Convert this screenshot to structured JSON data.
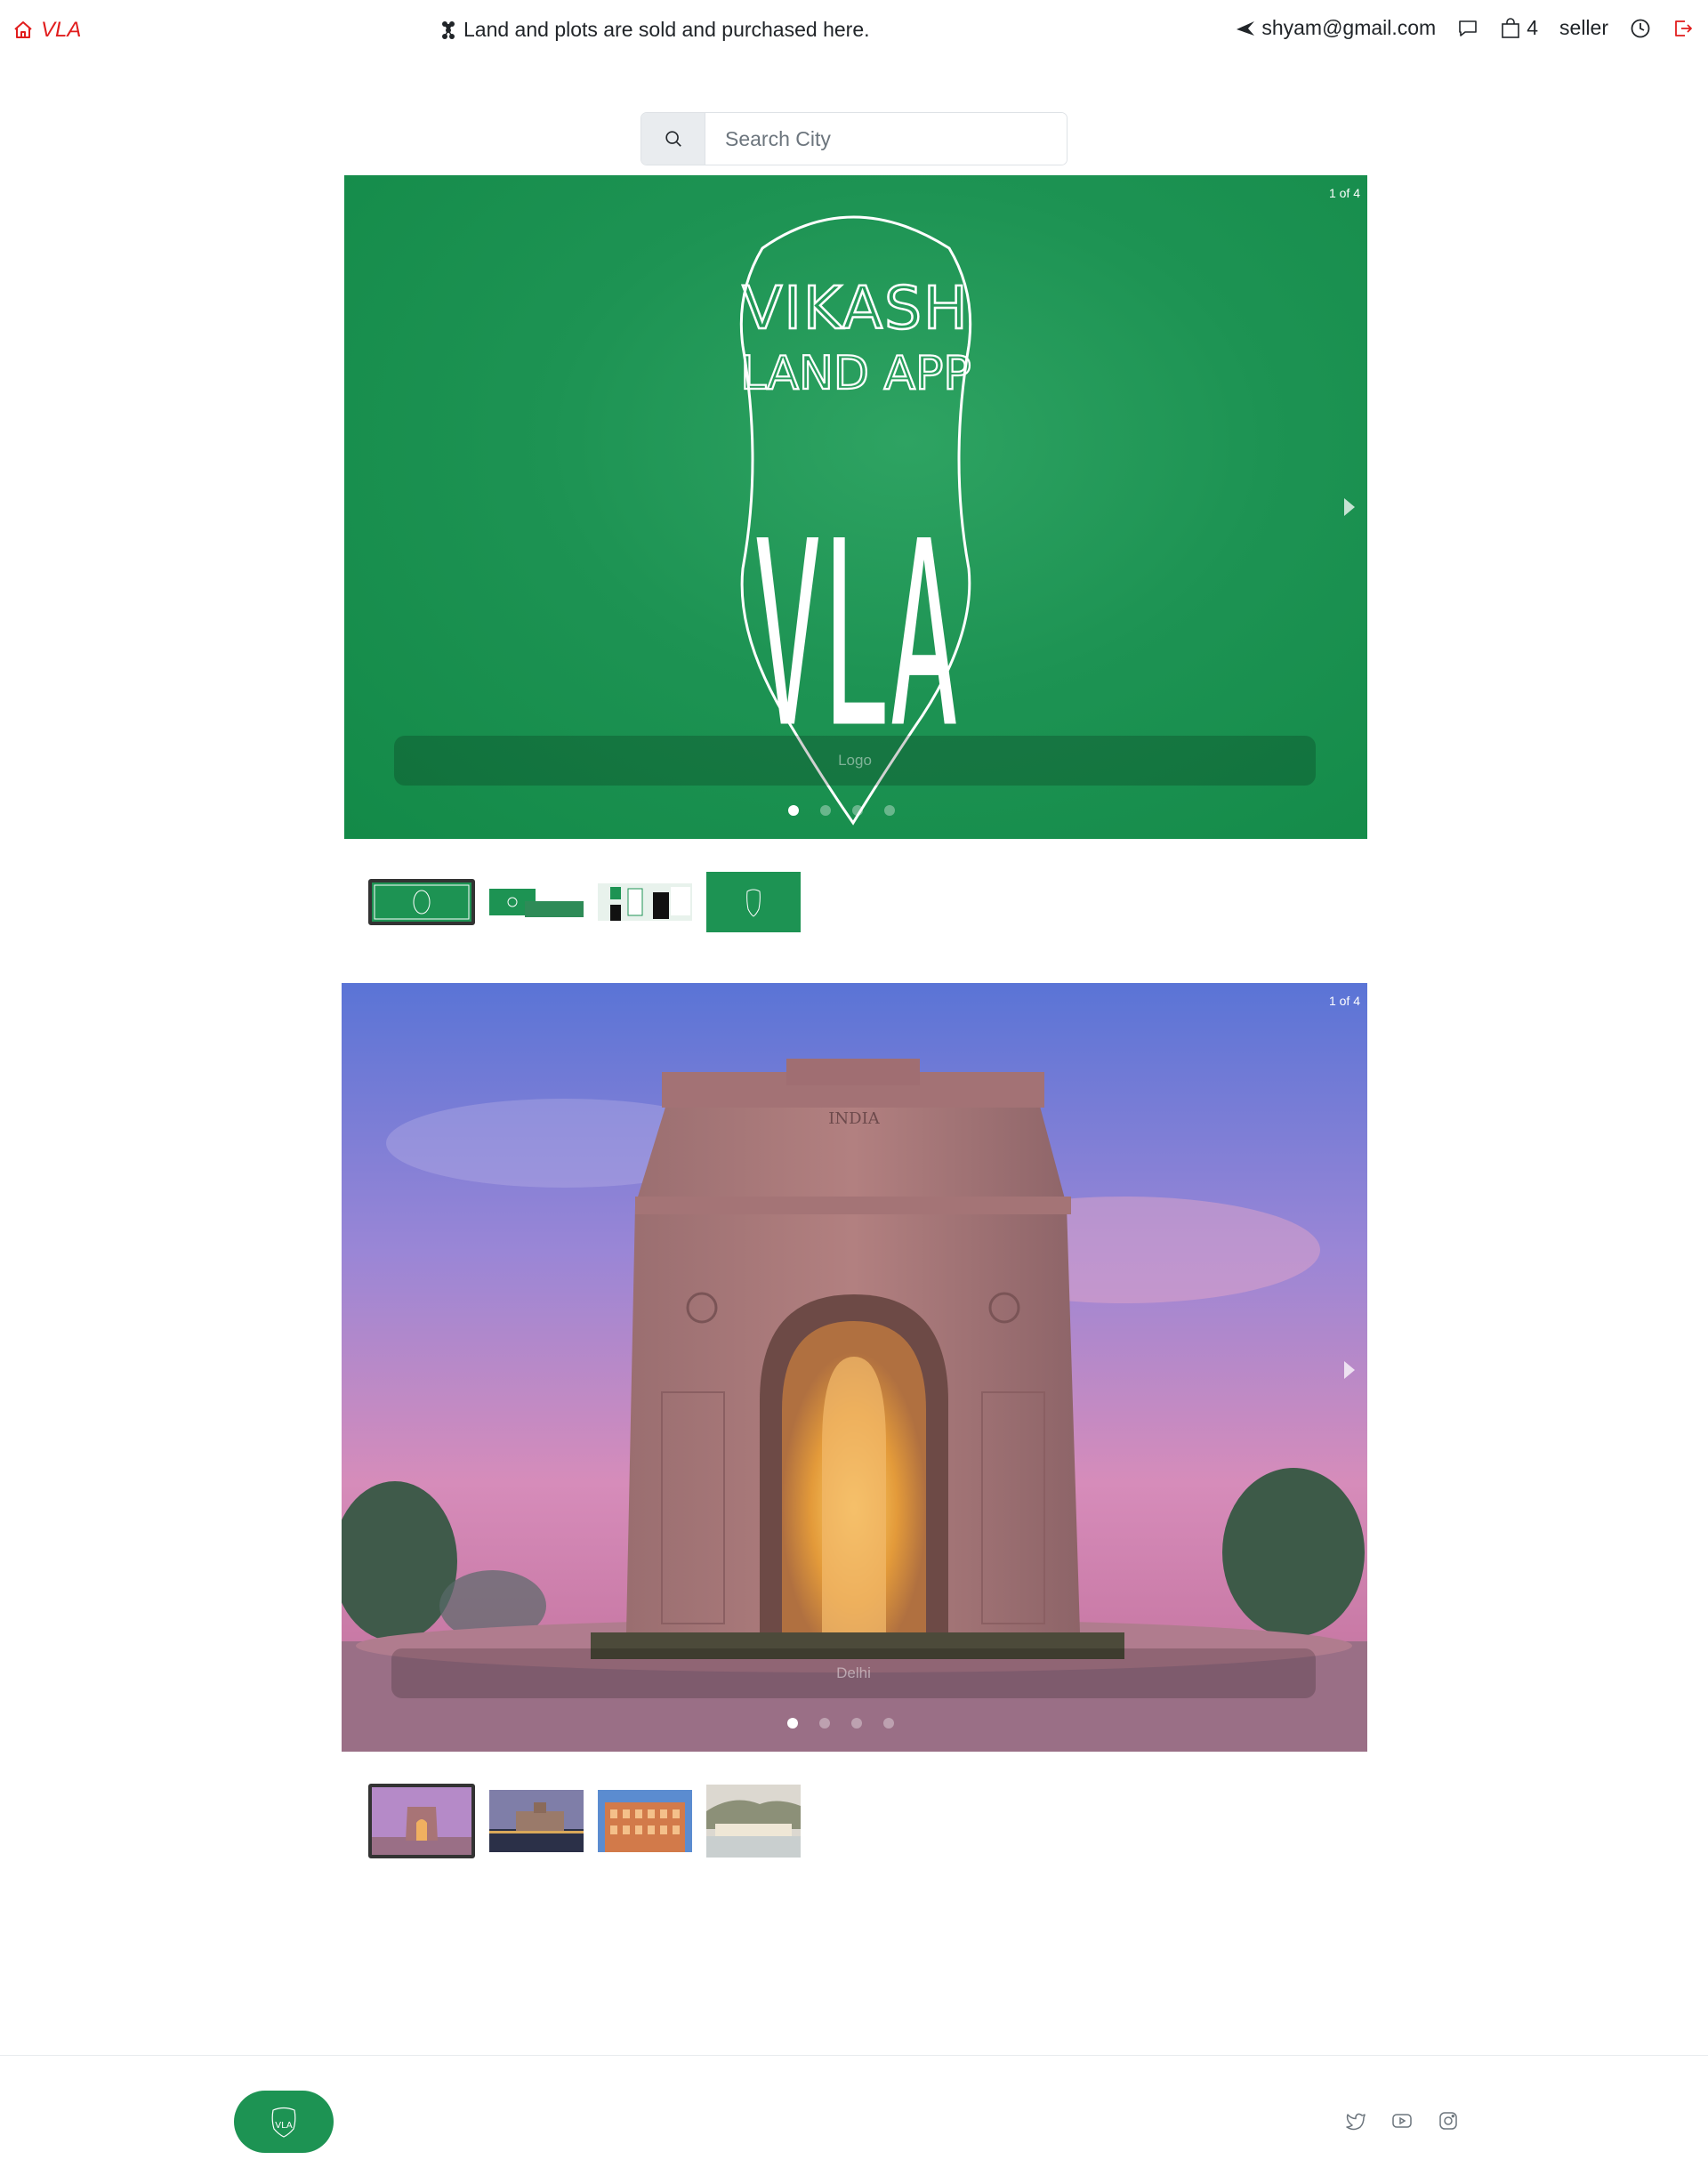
{
  "navbar": {
    "brand": "VLA",
    "tagline": "Land and plots are sold and purchased here.",
    "email": "shyam@gmail.com",
    "cart_count": "4",
    "role": "seller"
  },
  "search": {
    "placeholder": "Search City"
  },
  "carousel1": {
    "counter": "1 of 4",
    "caption": "Logo",
    "logo_text_line1": "VIKASH",
    "logo_text_line2": "LAND APP",
    "logo_monogram": "VLA",
    "slide_count": 4,
    "active_index": 0
  },
  "carousel2": {
    "counter": "1 of 4",
    "caption": "Delhi",
    "monument_inscription": "INDIA",
    "slide_count": 4,
    "active_index": 0
  },
  "colors": {
    "brand_red": "#e11d1d",
    "brand_green": "#1d9353"
  },
  "icons": {
    "home": "home-icon",
    "network": "network-icon",
    "send": "send-icon",
    "chat": "chat-icon",
    "bag": "bag-icon",
    "history": "clock-icon",
    "logout": "logout-icon",
    "search": "search-icon",
    "twitter": "twitter-icon",
    "youtube": "youtube-icon",
    "instagram": "instagram-icon"
  }
}
